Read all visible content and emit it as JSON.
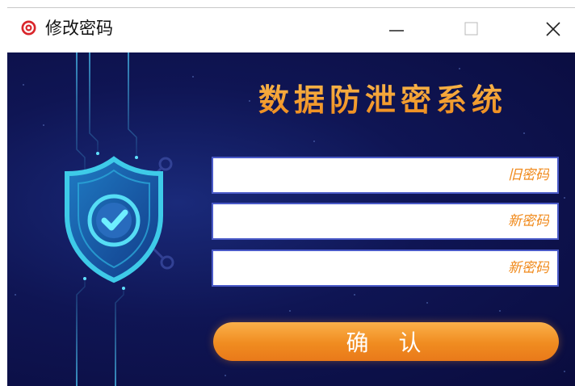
{
  "window": {
    "title": "修改密码",
    "controls": {
      "minimize": "—",
      "maximize": "☐",
      "close": "✕"
    }
  },
  "main": {
    "system_title": "数据防泄密系统",
    "fields": {
      "old_password_placeholder": "旧密码",
      "new_password_placeholder": "新密码",
      "confirm_password_placeholder": "新密码"
    },
    "confirm_label": "确 认"
  },
  "colors": {
    "accent_orange": "#f08c20",
    "background_navy": "#0f1554",
    "field_border": "#4a5ac8",
    "shield_cyan": "#3ecbe8"
  },
  "icons": {
    "app": "target-icon",
    "shield": "shield-check-icon"
  }
}
